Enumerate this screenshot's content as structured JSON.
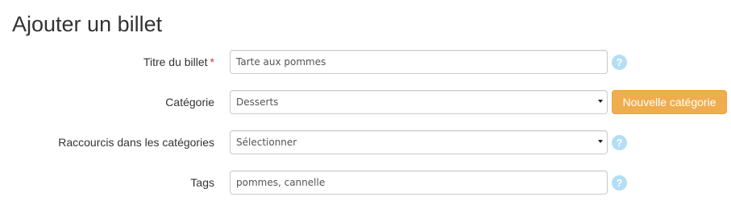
{
  "page": {
    "title": "Ajouter un billet"
  },
  "form": {
    "title_field": {
      "label": "Titre du billet",
      "required_marker": "*",
      "value": "Tarte aux pommes",
      "help_icon": "question-mark-icon"
    },
    "category_field": {
      "label": "Catégorie",
      "selected": "Desserts",
      "new_category_button": "Nouvelle catégorie"
    },
    "shortcut_field": {
      "label": "Raccourcis dans les catégories",
      "selected": "Sélectionner",
      "help_icon": "question-mark-icon"
    },
    "tags_field": {
      "label": "Tags",
      "value": "pommes, cannelle",
      "help_icon": "question-mark-icon"
    },
    "help_glyph": "?"
  },
  "colors": {
    "accent_button": "#f0ad4e",
    "help_icon": "#b3def5",
    "required": "#c0392b"
  }
}
